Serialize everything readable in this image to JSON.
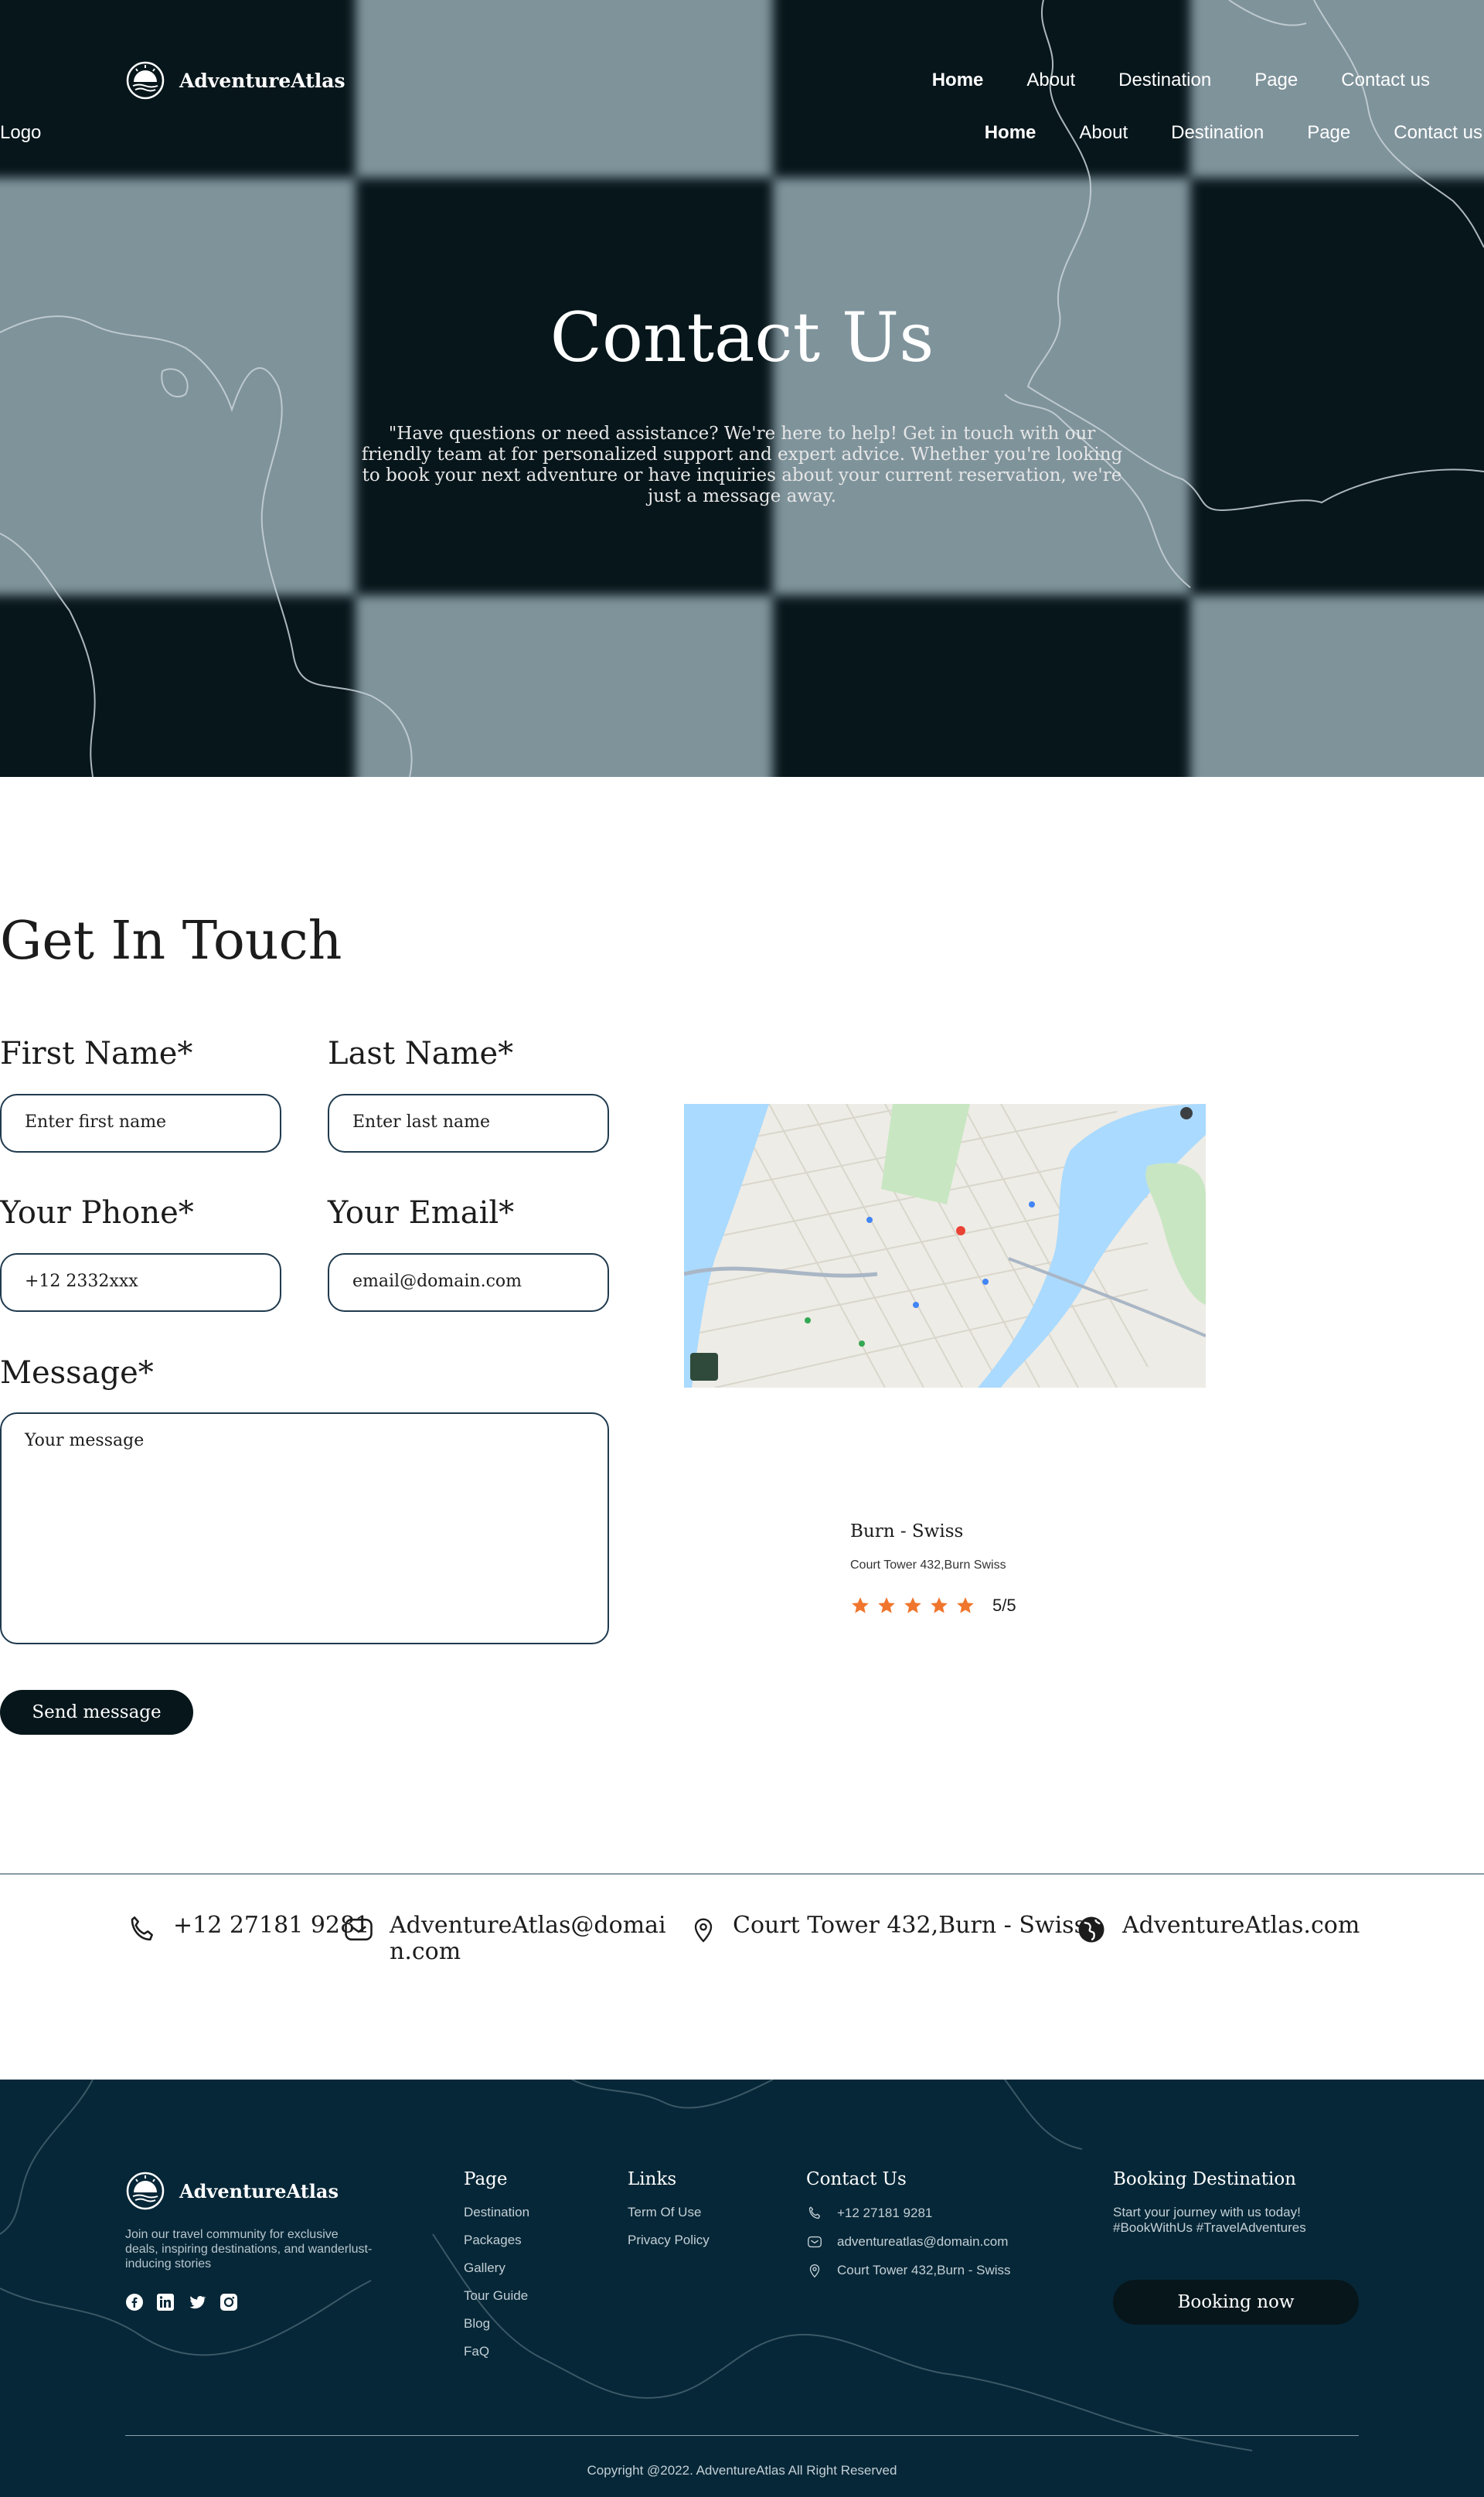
{
  "header": {
    "brand": "AdventureAtlas",
    "logo_text": "Logo",
    "nav": [
      "Home",
      "About",
      "Destination",
      "Page",
      "Contact us"
    ],
    "nav_secondary": [
      "Home",
      "About",
      "Destination",
      "Page",
      "Contact us"
    ]
  },
  "hero": {
    "title": "Contact Us",
    "subtitle": "\"Have questions or need assistance? We're here to help! Get in touch with our friendly team at  for personalized support and expert advice. Whether you're looking to book your next adventure or have inquiries about your current reservation, we're just a message away."
  },
  "form": {
    "heading": "Get In Touch",
    "first_name_label": "First Name*",
    "first_name_placeholder": "Enter first name",
    "last_name_label": "Last Name*",
    "last_name_placeholder": "Enter last name",
    "phone_label": "Your Phone*",
    "phone_placeholder": "+12 2332xxx",
    "email_label": "Your Email*",
    "email_placeholder": "email@domain.com",
    "message_label": "Message*",
    "message_placeholder": "Your message",
    "submit_label": "Send message"
  },
  "location": {
    "name": "Burn - Swiss",
    "address": "Court Tower 432,Burn Swiss",
    "rating_stars": 5,
    "rating_text": "5/5",
    "star_color": "#f0762d"
  },
  "contact_strip": {
    "phone": "+12 27181 9281",
    "email": "AdventureAtlas@domain.com",
    "address": "Court Tower 432,Burn - Swiss",
    "website": "AdventureAtlas.com"
  },
  "footer": {
    "brand": "AdventureAtlas",
    "description": "Join our travel community for exclusive deals, inspiring destinations, and wanderlust-inducing stories",
    "social_icons": [
      "facebook-icon",
      "linkedin-icon",
      "twitter-icon",
      "instagram-icon"
    ],
    "page_heading": "Page",
    "page_links": [
      "Destination",
      "Packages",
      "Gallery",
      "Tour Guide",
      "Blog",
      "FaQ"
    ],
    "links_heading": "Links",
    "links": [
      "Term Of Use",
      "Privacy Policy"
    ],
    "contact_heading": "Contact Us",
    "contact_phone": "+12 27181 9281",
    "contact_email": "adventureatlas@domain.com",
    "contact_address": "Court Tower 432,Burn - Swiss",
    "booking_heading": "Booking Destination",
    "booking_desc": "Start your journey with us today! #BookWithUs #TravelAdventures",
    "booking_button": "Booking now",
    "copyright": "Copyright @2022. AdventureAtlas All Right Reserved"
  },
  "colors": {
    "dark": "#07161b",
    "footer_bg": "#062737",
    "check_light": "#7f939b",
    "accent_star": "#f0762d"
  }
}
